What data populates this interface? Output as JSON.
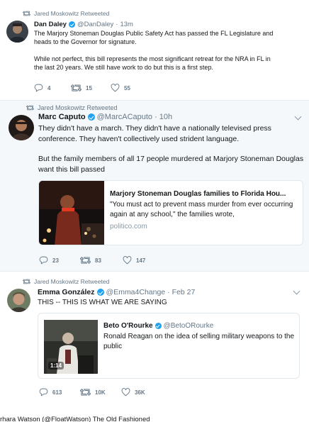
{
  "tweets": [
    {
      "retweeted_by": "Jared Moskowitz Retweeted",
      "name": "Dan Daley",
      "handle": "@DanDaley",
      "time": "13m",
      "paragraph1": "The Marjory Stoneman Douglas Public Safety Act has passed the FL Legislature and heads to the Governor for signature.",
      "paragraph2": "While not perfect, this bill represents the most significant retreat for the NRA in FL in the last 20 years. We still have work to do but this is a first step.",
      "replies": "4",
      "retweets": "15",
      "likes": "55"
    },
    {
      "retweeted_by": "Jared Moskowitz Retweeted",
      "name": "Marc Caputo",
      "handle": "@MarcACaputo",
      "time": "10h",
      "paragraph1": "They didn't have a march. They didn't have a nationally televised press conference. They haven't collectively used strident language.",
      "paragraph2": "But the family members of all 17 people murdered at Marjory Stoneman Douglas want this bill passed",
      "card": {
        "title": "Marjory Stoneman Douglas families to Florida Hou...",
        "description": "\"You must act to prevent mass murder from ever occurring again at any school,\" the families wrote,",
        "domain": "politico.com"
      },
      "replies": "23",
      "retweets": "83",
      "likes": "147"
    },
    {
      "retweeted_by": "Jared Moskowitz Retweeted",
      "name": "Emma González",
      "handle": "@Emma4Change",
      "time": "Feb 27",
      "paragraph1": "THIS -- THIS IS WHAT WE ARE SAYING",
      "quote": {
        "name": "Beto O'Rourke",
        "handle": "@BetoORourke",
        "text": "Ronald Reagan on the idea of selling military weapons to the public",
        "duration": "1:14"
      },
      "replies": "613",
      "retweets": "10K",
      "likes": "36K"
    }
  ],
  "footer": {
    "text": "rhara Watson (@FloatWatson) The Old Fashioned"
  },
  "colors": {
    "accent": "#1da1f2",
    "muted": "#657786",
    "text": "#14171a",
    "link": "#8899a6"
  },
  "icons": [
    "retweet-icon",
    "reply-icon",
    "like-icon",
    "verified-icon",
    "chevron-down-icon"
  ]
}
